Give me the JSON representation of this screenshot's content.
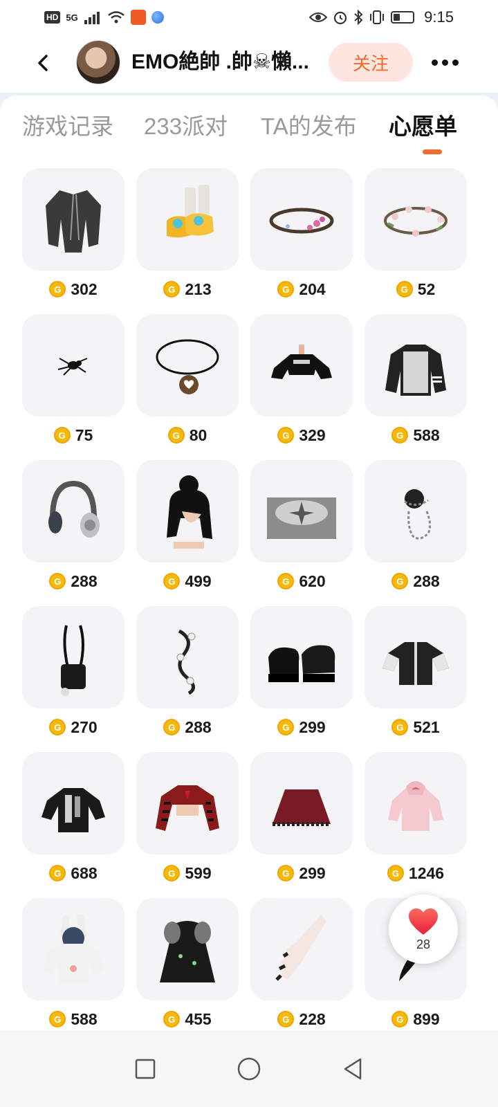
{
  "status_bar": {
    "hd_badge": "HD",
    "network": "5G",
    "time": "9:15"
  },
  "header": {
    "username": "EMO絶帥 .帥☠懶...",
    "follow_label": "关注"
  },
  "tabs": [
    {
      "label": "游戏记录"
    },
    {
      "label": "233派对"
    },
    {
      "label": "TA的发布"
    },
    {
      "label": "心愿单"
    }
  ],
  "active_tab": "心愿单",
  "coin_symbol": "G",
  "items": [
    {
      "icon": "jacket-icon",
      "price": "302"
    },
    {
      "icon": "boots-icon",
      "price": "213"
    },
    {
      "icon": "thorn-crown-icon",
      "price": "204"
    },
    {
      "icon": "flower-crown-icon",
      "price": "52"
    },
    {
      "icon": "spider-icon",
      "price": "75"
    },
    {
      "icon": "heart-choker-icon",
      "price": "80"
    },
    {
      "icon": "crop-hoodie-icon",
      "price": "329"
    },
    {
      "icon": "graphic-sweater-icon",
      "price": "588"
    },
    {
      "icon": "headphones-icon",
      "price": "288"
    },
    {
      "icon": "bun-hairstyle-icon",
      "price": "499"
    },
    {
      "icon": "sparkle-floor-icon",
      "price": "620"
    },
    {
      "icon": "chain-bun-icon",
      "price": "288"
    },
    {
      "icon": "crossbody-bag-icon",
      "price": "270"
    },
    {
      "icon": "flower-strand-icon",
      "price": "288"
    },
    {
      "icon": "platform-shoes-icon",
      "price": "299"
    },
    {
      "icon": "varsity-jacket-icon",
      "price": "521"
    },
    {
      "icon": "print-jacket-icon",
      "price": "688"
    },
    {
      "icon": "striped-top-icon",
      "price": "599"
    },
    {
      "icon": "red-skirt-icon",
      "price": "299"
    },
    {
      "icon": "pink-hoodie-icon",
      "price": "1246"
    },
    {
      "icon": "bunny-hoodie-icon",
      "price": "588"
    },
    {
      "icon": "gothic-dress-icon",
      "price": "455"
    },
    {
      "icon": "hand-nails-icon",
      "price": "228"
    },
    {
      "icon": "black-tail-icon",
      "price": "899"
    }
  ],
  "like": {
    "count": "28"
  },
  "colors": {
    "accent": "#f26a2e",
    "follow_bg": "#fde6df",
    "coin": "#f5b90b",
    "card_bg": "#f4f4f6",
    "header_band": "#e8f2fb"
  }
}
